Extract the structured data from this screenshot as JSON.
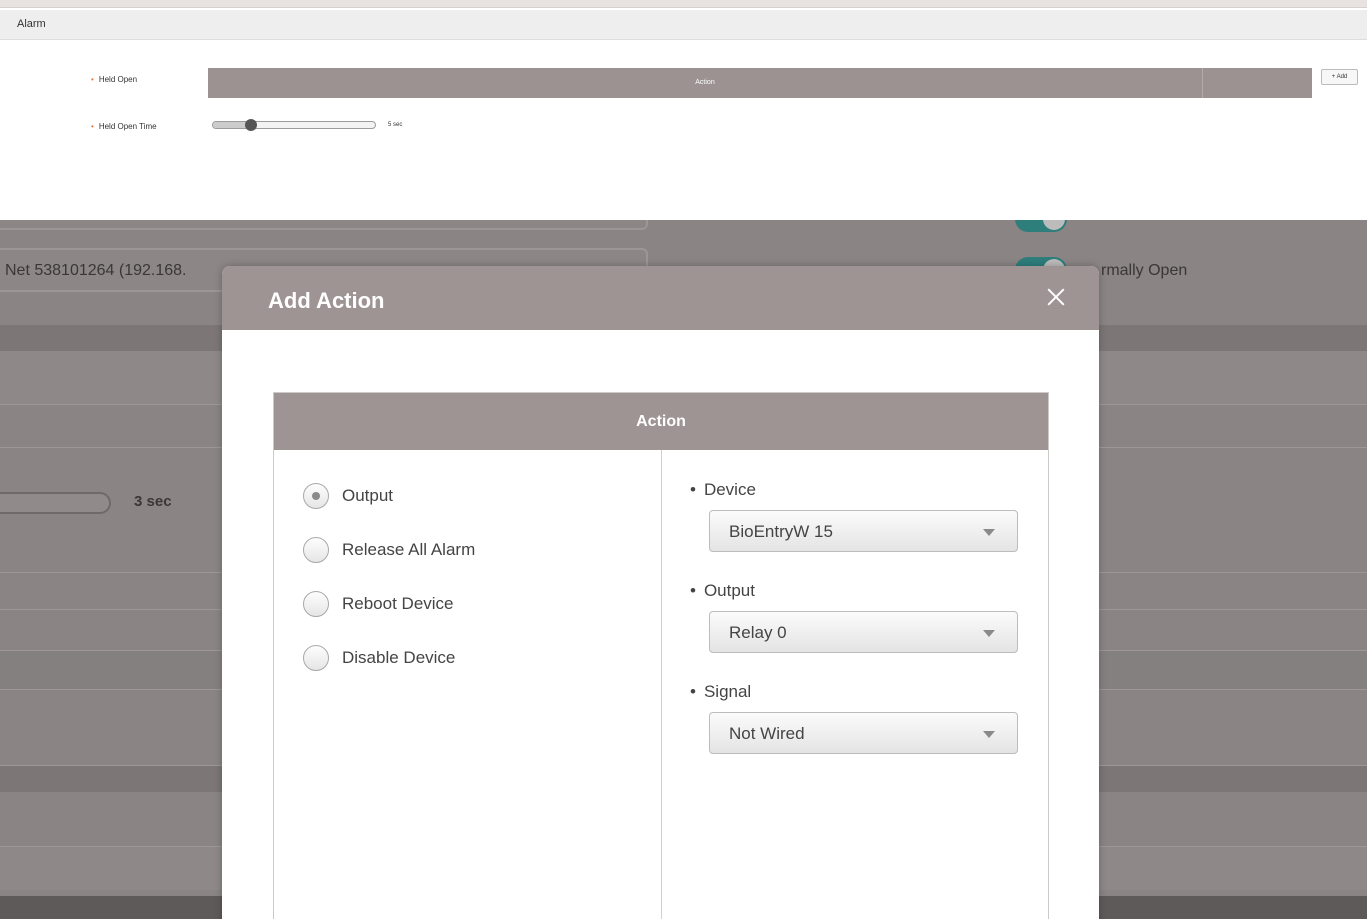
{
  "alarm": {
    "title": "Alarm",
    "held_open_label": "Held Open",
    "held_open_time_label": "Held Open Time",
    "action_column": "Action",
    "add_button": "+ Add",
    "slider": {
      "value_text": "5 sec",
      "level": 0.24
    }
  },
  "background": {
    "device_text": "Net 538101264 (192.168.",
    "switch_text": "rmally Open",
    "slider_value": "3 sec"
  },
  "modal": {
    "title": "Add Action",
    "panel_title": "Action",
    "action_types": [
      {
        "label": "Output",
        "selected": true
      },
      {
        "label": "Release All Alarm",
        "selected": false
      },
      {
        "label": "Reboot Device",
        "selected": false
      },
      {
        "label": "Disable Device",
        "selected": false
      }
    ],
    "fields": {
      "device": {
        "label": "Device",
        "value": "BioEntryW 15"
      },
      "output": {
        "label": "Output",
        "value": "Relay 0"
      },
      "signal": {
        "label": "Signal",
        "value": "Not Wired"
      }
    }
  },
  "colors": {
    "header_bar": "#9f9494",
    "overlay": "#8a8484",
    "toggle_on": "#2e7e7c",
    "required_dot": "#e07b3f"
  }
}
